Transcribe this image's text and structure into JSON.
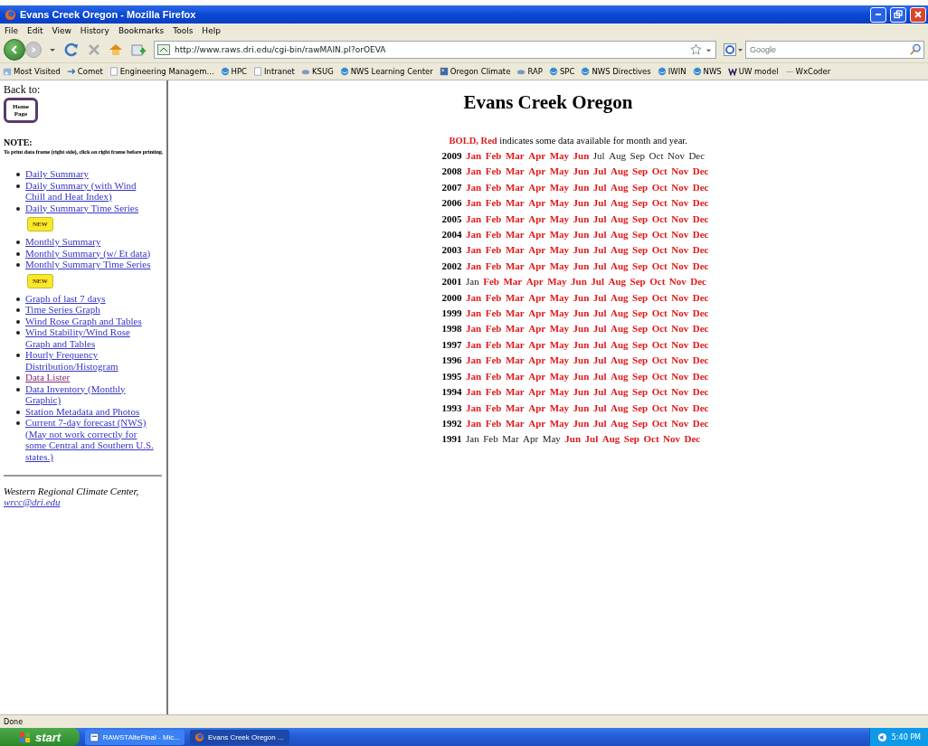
{
  "window": {
    "title": "Evans Creek Oregon - Mozilla Firefox"
  },
  "menu": [
    "File",
    "Edit",
    "View",
    "History",
    "Bookmarks",
    "Tools",
    "Help"
  ],
  "address": {
    "value": "http://www.raws.dri.edu/cgi-bin/rawMAIN.pl?orOEVA"
  },
  "search": {
    "placeholder": "Google"
  },
  "bookmarks": [
    {
      "label": "Most Visited",
      "kind": "folder"
    },
    {
      "label": "Comet",
      "kind": "arrow"
    },
    {
      "label": "Engineering Managem...",
      "kind": "page"
    },
    {
      "label": "HPC",
      "kind": "globe"
    },
    {
      "label": "Intranet",
      "kind": "page"
    },
    {
      "label": "KSUG",
      "kind": "cloud"
    },
    {
      "label": "NWS Learning Center",
      "kind": "globe"
    },
    {
      "label": "Oregon Climate",
      "kind": "tile"
    },
    {
      "label": "RAP",
      "kind": "cloud"
    },
    {
      "label": "SPC",
      "kind": "globe"
    },
    {
      "label": "NWS Directives",
      "kind": "globe"
    },
    {
      "label": "IWIN",
      "kind": "globe"
    },
    {
      "label": "NWS",
      "kind": "globe"
    },
    {
      "label": "UW model",
      "kind": "w"
    },
    {
      "label": "WxCoder",
      "kind": "blank"
    }
  ],
  "sidebar": {
    "back_label": "Back to:",
    "home_button": "Home Page",
    "note_heading": "NOTE:",
    "note_text": "To print data frame (right side), click on right frame before printing.",
    "links": [
      {
        "label": "Daily Summary",
        "visited": false
      },
      {
        "label": "Daily Summary (with Wind Chill and Heat Index)",
        "visited": false
      },
      {
        "label": "Daily Summary Time Series",
        "visited": false,
        "badge": "NEW"
      },
      {
        "label": "Monthly Summary",
        "visited": false
      },
      {
        "label": "Monthly Summary (w/ Et data)",
        "visited": false
      },
      {
        "label": "Monthly Summary Time Series",
        "visited": false,
        "badge": "NEW"
      },
      {
        "label": "Graph of last 7 days",
        "visited": false
      },
      {
        "label": "Time Series Graph",
        "visited": false
      },
      {
        "label": "Wind Rose Graph and Tables",
        "visited": false
      },
      {
        "label": "Wind Stability/Wind Rose Graph and Tables",
        "visited": false
      },
      {
        "label": "Hourly Frequency Distribution/Histogram",
        "visited": false
      },
      {
        "label": "Data Lister",
        "visited": true
      },
      {
        "label": "Data Inventory (Monthly Graphic)",
        "visited": false
      },
      {
        "label": "Station Metadata and Photos",
        "visited": false
      },
      {
        "label": "Current 7-day forecast (NWS) (May not work correctly for some Central and Southern U.S. states.)",
        "visited": false
      }
    ],
    "footer_text": "Western Regional Climate Center,",
    "footer_link": "wrcc@dri.edu"
  },
  "main": {
    "heading": "Evans Creek Oregon",
    "legend": "**BOLD, Red** indicates some data available for month and year.",
    "rows": [
      {
        "year": "2009",
        "months": [
          {
            "label": "Jan",
            "available": true
          },
          {
            "label": "Feb",
            "available": true
          },
          {
            "label": "Mar",
            "available": true
          },
          {
            "label": "Apr",
            "available": true
          },
          {
            "label": "May",
            "available": true
          },
          {
            "label": "Jun",
            "available": true
          },
          {
            "label": "Jul",
            "available": false
          },
          {
            "label": "Aug",
            "available": false
          },
          {
            "label": "Sep",
            "available": false
          },
          {
            "label": "Oct",
            "available": false
          },
          {
            "label": "Nov",
            "available": false
          },
          {
            "label": "Dec",
            "available": false
          }
        ]
      },
      {
        "year": "2008",
        "months": [
          {
            "label": "Jan",
            "available": true
          },
          {
            "label": "Feb",
            "available": true
          },
          {
            "label": "Mar",
            "available": true
          },
          {
            "label": "Apr",
            "available": true
          },
          {
            "label": "May",
            "available": true
          },
          {
            "label": "Jun",
            "available": true
          },
          {
            "label": "Jul",
            "available": true
          },
          {
            "label": "Aug",
            "available": true
          },
          {
            "label": "Sep",
            "available": true
          },
          {
            "label": "Oct",
            "available": true
          },
          {
            "label": "Nov",
            "available": true
          },
          {
            "label": "Dec",
            "available": true
          }
        ]
      },
      {
        "year": "2007",
        "months": [
          {
            "label": "Jan",
            "available": true
          },
          {
            "label": "Feb",
            "available": true
          },
          {
            "label": "Mar",
            "available": true
          },
          {
            "label": "Apr",
            "available": true
          },
          {
            "label": "May",
            "available": true
          },
          {
            "label": "Jun",
            "available": true
          },
          {
            "label": "Jul",
            "available": true
          },
          {
            "label": "Aug",
            "available": true
          },
          {
            "label": "Sep",
            "available": true
          },
          {
            "label": "Oct",
            "available": true
          },
          {
            "label": "Nov",
            "available": true
          },
          {
            "label": "Dec",
            "available": true
          }
        ]
      },
      {
        "year": "2006",
        "months": [
          {
            "label": "Jan",
            "available": true
          },
          {
            "label": "Feb",
            "available": true
          },
          {
            "label": "Mar",
            "available": true
          },
          {
            "label": "Apr",
            "available": true
          },
          {
            "label": "May",
            "available": true
          },
          {
            "label": "Jun",
            "available": true
          },
          {
            "label": "Jul",
            "available": true
          },
          {
            "label": "Aug",
            "available": true
          },
          {
            "label": "Sep",
            "available": true
          },
          {
            "label": "Oct",
            "available": true
          },
          {
            "label": "Nov",
            "available": true
          },
          {
            "label": "Dec",
            "available": true
          }
        ]
      },
      {
        "year": "2005",
        "months": [
          {
            "label": "Jan",
            "available": true
          },
          {
            "label": "Feb",
            "available": true
          },
          {
            "label": "Mar",
            "available": true
          },
          {
            "label": "Apr",
            "available": true
          },
          {
            "label": "May",
            "available": true
          },
          {
            "label": "Jun",
            "available": true
          },
          {
            "label": "Jul",
            "available": true
          },
          {
            "label": "Aug",
            "available": true
          },
          {
            "label": "Sep",
            "available": true
          },
          {
            "label": "Oct",
            "available": true
          },
          {
            "label": "Nov",
            "available": true
          },
          {
            "label": "Dec",
            "available": true
          }
        ]
      },
      {
        "year": "2004",
        "months": [
          {
            "label": "Jan",
            "available": true
          },
          {
            "label": "Feb",
            "available": true
          },
          {
            "label": "Mar",
            "available": true
          },
          {
            "label": "Apr",
            "available": true
          },
          {
            "label": "May",
            "available": true
          },
          {
            "label": "Jun",
            "available": true
          },
          {
            "label": "Jul",
            "available": true
          },
          {
            "label": "Aug",
            "available": true
          },
          {
            "label": "Sep",
            "available": true
          },
          {
            "label": "Oct",
            "available": true
          },
          {
            "label": "Nov",
            "available": true
          },
          {
            "label": "Dec",
            "available": true
          }
        ]
      },
      {
        "year": "2003",
        "months": [
          {
            "label": "Jan",
            "available": true
          },
          {
            "label": "Feb",
            "available": true
          },
          {
            "label": "Mar",
            "available": true
          },
          {
            "label": "Apr",
            "available": true
          },
          {
            "label": "May",
            "available": true
          },
          {
            "label": "Jun",
            "available": true
          },
          {
            "label": "Jul",
            "available": true
          },
          {
            "label": "Aug",
            "available": true
          },
          {
            "label": "Sep",
            "available": true
          },
          {
            "label": "Oct",
            "available": true
          },
          {
            "label": "Nov",
            "available": true
          },
          {
            "label": "Dec",
            "available": true
          }
        ]
      },
      {
        "year": "2002",
        "months": [
          {
            "label": "Jan",
            "available": true
          },
          {
            "label": "Feb",
            "available": true
          },
          {
            "label": "Mar",
            "available": true
          },
          {
            "label": "Apr",
            "available": true
          },
          {
            "label": "May",
            "available": true
          },
          {
            "label": "Jun",
            "available": true
          },
          {
            "label": "Jul",
            "available": true
          },
          {
            "label": "Aug",
            "available": true
          },
          {
            "label": "Sep",
            "available": true
          },
          {
            "label": "Oct",
            "available": true
          },
          {
            "label": "Nov",
            "available": true
          },
          {
            "label": "Dec",
            "available": true
          }
        ]
      },
      {
        "year": "2001",
        "months": [
          {
            "label": "Jan",
            "available": false
          },
          {
            "label": "Feb",
            "available": true
          },
          {
            "label": "Mar",
            "available": true
          },
          {
            "label": "Apr",
            "available": true
          },
          {
            "label": "May",
            "available": true
          },
          {
            "label": "Jun",
            "available": true
          },
          {
            "label": "Jul",
            "available": true
          },
          {
            "label": "Aug",
            "available": true
          },
          {
            "label": "Sep",
            "available": true
          },
          {
            "label": "Oct",
            "available": true
          },
          {
            "label": "Nov",
            "available": true
          },
          {
            "label": "Dec",
            "available": true
          }
        ]
      },
      {
        "year": "2000",
        "months": [
          {
            "label": "Jan",
            "available": true
          },
          {
            "label": "Feb",
            "available": true
          },
          {
            "label": "Mar",
            "available": true
          },
          {
            "label": "Apr",
            "available": true
          },
          {
            "label": "May",
            "available": true
          },
          {
            "label": "Jun",
            "available": true
          },
          {
            "label": "Jul",
            "available": true
          },
          {
            "label": "Aug",
            "available": true
          },
          {
            "label": "Sep",
            "available": true
          },
          {
            "label": "Oct",
            "available": true
          },
          {
            "label": "Nov",
            "available": true
          },
          {
            "label": "Dec",
            "available": true
          }
        ]
      },
      {
        "year": "1999",
        "months": [
          {
            "label": "Jan",
            "available": true
          },
          {
            "label": "Feb",
            "available": true
          },
          {
            "label": "Mar",
            "available": true
          },
          {
            "label": "Apr",
            "available": true
          },
          {
            "label": "May",
            "available": true
          },
          {
            "label": "Jun",
            "available": true
          },
          {
            "label": "Jul",
            "available": true
          },
          {
            "label": "Aug",
            "available": true
          },
          {
            "label": "Sep",
            "available": true
          },
          {
            "label": "Oct",
            "available": true
          },
          {
            "label": "Nov",
            "available": true
          },
          {
            "label": "Dec",
            "available": true
          }
        ]
      },
      {
        "year": "1998",
        "months": [
          {
            "label": "Jan",
            "available": true
          },
          {
            "label": "Feb",
            "available": true
          },
          {
            "label": "Mar",
            "available": true
          },
          {
            "label": "Apr",
            "available": true
          },
          {
            "label": "May",
            "available": true
          },
          {
            "label": "Jun",
            "available": true
          },
          {
            "label": "Jul",
            "available": true
          },
          {
            "label": "Aug",
            "available": true
          },
          {
            "label": "Sep",
            "available": true
          },
          {
            "label": "Oct",
            "available": true
          },
          {
            "label": "Nov",
            "available": true
          },
          {
            "label": "Dec",
            "available": true
          }
        ]
      },
      {
        "year": "1997",
        "months": [
          {
            "label": "Jan",
            "available": true
          },
          {
            "label": "Feb",
            "available": true
          },
          {
            "label": "Mar",
            "available": true
          },
          {
            "label": "Apr",
            "available": true
          },
          {
            "label": "May",
            "available": true
          },
          {
            "label": "Jun",
            "available": true
          },
          {
            "label": "Jul",
            "available": true
          },
          {
            "label": "Aug",
            "available": true
          },
          {
            "label": "Sep",
            "available": true
          },
          {
            "label": "Oct",
            "available": true
          },
          {
            "label": "Nov",
            "available": true
          },
          {
            "label": "Dec",
            "available": true
          }
        ]
      },
      {
        "year": "1996",
        "months": [
          {
            "label": "Jan",
            "available": true
          },
          {
            "label": "Feb",
            "available": true
          },
          {
            "label": "Mar",
            "available": true
          },
          {
            "label": "Apr",
            "available": true
          },
          {
            "label": "May",
            "available": true
          },
          {
            "label": "Jun",
            "available": true
          },
          {
            "label": "Jul",
            "available": true
          },
          {
            "label": "Aug",
            "available": true
          },
          {
            "label": "Sep",
            "available": true
          },
          {
            "label": "Oct",
            "available": true
          },
          {
            "label": "Nov",
            "available": true
          },
          {
            "label": "Dec",
            "available": true
          }
        ]
      },
      {
        "year": "1995",
        "months": [
          {
            "label": "Jan",
            "available": true
          },
          {
            "label": "Feb",
            "available": true
          },
          {
            "label": "Mar",
            "available": true
          },
          {
            "label": "Apr",
            "available": true
          },
          {
            "label": "May",
            "available": true
          },
          {
            "label": "Jun",
            "available": true
          },
          {
            "label": "Jul",
            "available": true
          },
          {
            "label": "Aug",
            "available": true
          },
          {
            "label": "Sep",
            "available": true
          },
          {
            "label": "Oct",
            "available": true
          },
          {
            "label": "Nov",
            "available": true
          },
          {
            "label": "Dec",
            "available": true
          }
        ]
      },
      {
        "year": "1994",
        "months": [
          {
            "label": "Jan",
            "available": true
          },
          {
            "label": "Feb",
            "available": true
          },
          {
            "label": "Mar",
            "available": true
          },
          {
            "label": "Apr",
            "available": true
          },
          {
            "label": "May",
            "available": true
          },
          {
            "label": "Jun",
            "available": true
          },
          {
            "label": "Jul",
            "available": true
          },
          {
            "label": "Aug",
            "available": true
          },
          {
            "label": "Sep",
            "available": true
          },
          {
            "label": "Oct",
            "available": true
          },
          {
            "label": "Nov",
            "available": true
          },
          {
            "label": "Dec",
            "available": true
          }
        ]
      },
      {
        "year": "1993",
        "months": [
          {
            "label": "Jan",
            "available": true
          },
          {
            "label": "Feb",
            "available": true
          },
          {
            "label": "Mar",
            "available": true
          },
          {
            "label": "Apr",
            "available": true
          },
          {
            "label": "May",
            "available": true
          },
          {
            "label": "Jun",
            "available": true
          },
          {
            "label": "Jul",
            "available": true
          },
          {
            "label": "Aug",
            "available": true
          },
          {
            "label": "Sep",
            "available": true
          },
          {
            "label": "Oct",
            "available": true
          },
          {
            "label": "Nov",
            "available": true
          },
          {
            "label": "Dec",
            "available": true
          }
        ]
      },
      {
        "year": "1992",
        "months": [
          {
            "label": "Jan",
            "available": true
          },
          {
            "label": "Feb",
            "available": true
          },
          {
            "label": "Mar",
            "available": true
          },
          {
            "label": "Apr",
            "available": true
          },
          {
            "label": "May",
            "available": true
          },
          {
            "label": "Jun",
            "available": true
          },
          {
            "label": "Jul",
            "available": true
          },
          {
            "label": "Aug",
            "available": true
          },
          {
            "label": "Sep",
            "available": true
          },
          {
            "label": "Oct",
            "available": true
          },
          {
            "label": "Nov",
            "available": true
          },
          {
            "label": "Dec",
            "available": true
          }
        ]
      },
      {
        "year": "1991",
        "months": [
          {
            "label": "Jan",
            "available": false
          },
          {
            "label": "Feb",
            "available": false
          },
          {
            "label": "Mar",
            "available": false
          },
          {
            "label": "Apr",
            "available": false
          },
          {
            "label": "May",
            "available": false
          },
          {
            "label": "Jun",
            "available": true
          },
          {
            "label": "Jul",
            "available": true
          },
          {
            "label": "Aug",
            "available": true
          },
          {
            "label": "Sep",
            "available": true
          },
          {
            "label": "Oct",
            "available": true
          },
          {
            "label": "Nov",
            "available": true
          },
          {
            "label": "Dec",
            "available": true
          }
        ]
      }
    ]
  },
  "status_bar": {
    "text": "Done"
  },
  "taskbar": {
    "start": "start",
    "tasks": [
      {
        "label": "RAWSTAlteFinal - Mic...",
        "selected": false,
        "kind": "doc"
      },
      {
        "label": "Evans Creek Oregon ...",
        "selected": true,
        "kind": "browser"
      }
    ],
    "clock": "5:40 PM"
  }
}
